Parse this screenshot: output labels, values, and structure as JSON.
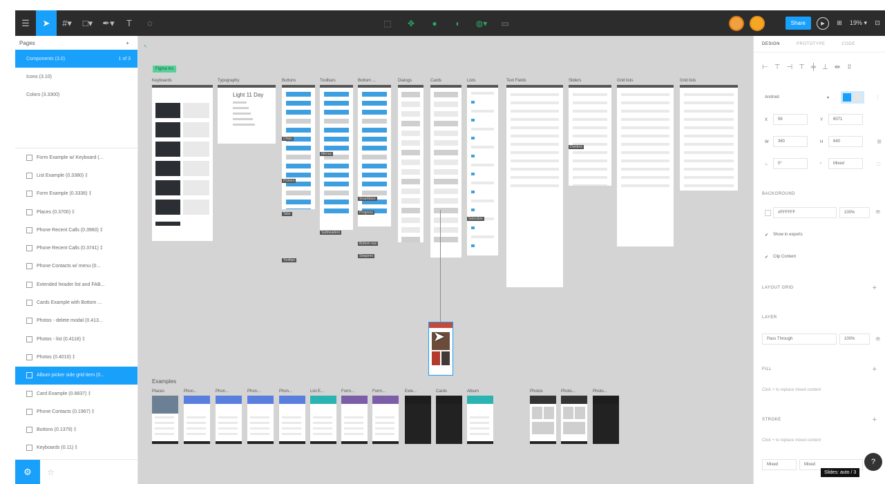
{
  "toolbar": {
    "left_icons": [
      "menu-icon",
      "move-tool-icon",
      "frame-tool-icon",
      "shape-tool-icon",
      "pen-tool-icon",
      "text-tool-icon",
      "comment-tool-icon"
    ],
    "left_glyphs": [
      "☰",
      "➤",
      "#▾",
      "□▾",
      "✒▾",
      "T",
      "◌"
    ],
    "center_glyphs": [
      "⬚",
      "✥",
      "●",
      "◐",
      "◍▾",
      "▭"
    ],
    "share_label": "Share",
    "zoom_label": "19% ▾",
    "right_glyphs": [
      "⊞",
      "⊡"
    ]
  },
  "pages": {
    "header": "Pages",
    "add": "+",
    "items": [
      {
        "label": "Components (3.0)",
        "badge": "1 of 3",
        "selected": true
      },
      {
        "label": "Icons (3.10)"
      },
      {
        "label": "Colors (3.3300)"
      }
    ]
  },
  "layers": [
    "Form Example w/ Keyboard (...",
    "List Example (0.3380) ‡",
    "Form Example (0.3336) ‡",
    "Places (0.3700) ‡",
    "Phone Recent Calls (0.3960) ‡",
    "Phone Recent Calls (0.3741) ‡",
    "Phone Contacts w/ menu (0...",
    "Extended header list and FAB...",
    "Cards Example with Bottom ...",
    "Photos - delete modal (0.413...",
    "Photos - list (0.4118) ‡",
    "Photos (0.4010) ‡",
    "Album picker side grid item (0...",
    "Card Example (0.8837) ‡",
    "Phone Contacts (0.1967) ‡",
    "Buttons (0.1379) ‡",
    "Keyboards (0.11) ‡"
  ],
  "selected_layer_index": 12,
  "canvas": {
    "page_tag": "Figma Inc",
    "frames": [
      {
        "name": "Keyboards"
      },
      {
        "name": "Typography"
      },
      {
        "name": "Buttons"
      },
      {
        "name": "Toolbars"
      },
      {
        "name": "Bottom ..."
      },
      {
        "name": "Dialogs"
      },
      {
        "name": "Cards"
      },
      {
        "name": "Lists"
      },
      {
        "name": "Text Fields"
      },
      {
        "name": "Sliders"
      },
      {
        "name": "Grid lists"
      },
      {
        "name": "Grid lists"
      }
    ],
    "sub_labels": [
      "Chips",
      "Pickers",
      "Tabs",
      "Menus",
      "Snackbars",
      "Progress",
      "Bottom nav",
      "Selection",
      "Dividers",
      "Tooltips",
      "Subheaders",
      "Steppers"
    ],
    "typography_text": "Light 11 Day",
    "examples_label": "Examples",
    "examples": [
      "Places",
      "Phon...",
      "Phon...",
      "Phon...",
      "Phon...",
      "List E...",
      "Form...",
      "Form...",
      "Exte...",
      "Cards",
      "Album",
      "Photos",
      "Photo...",
      "Photo..."
    ]
  },
  "right_panel": {
    "tabs": [
      "DESIGN",
      "PROTOTYPE",
      "CODE"
    ],
    "device": "Android",
    "x": "56",
    "y": "6071",
    "w": "360",
    "h": "640",
    "rotation": "0°",
    "radius": "Mixed",
    "background_title": "BACKGROUND",
    "bg_hex": "#FFFFFF",
    "bg_opacity": "100%",
    "show_in_exports": "Show in exports",
    "clip_content": "Clip Content",
    "layout_grid": "LAYOUT GRID",
    "layer_title": "LAYER",
    "blend": "Pass Through",
    "layer_opacity": "100%",
    "fill_title": "FILL",
    "fill_hint": "Click + to replace mixed content",
    "stroke_title": "STROKE",
    "stroke_hint": "Click + to replace mixed content",
    "stroke_weight": "Mixed",
    "stroke_style": "Mixed"
  },
  "tooltip": "Slides: auto / 3",
  "colors": {
    "accent": "#18a0fb",
    "toolbar": "#2c2c2c",
    "canvas": "#d4d4d4"
  }
}
